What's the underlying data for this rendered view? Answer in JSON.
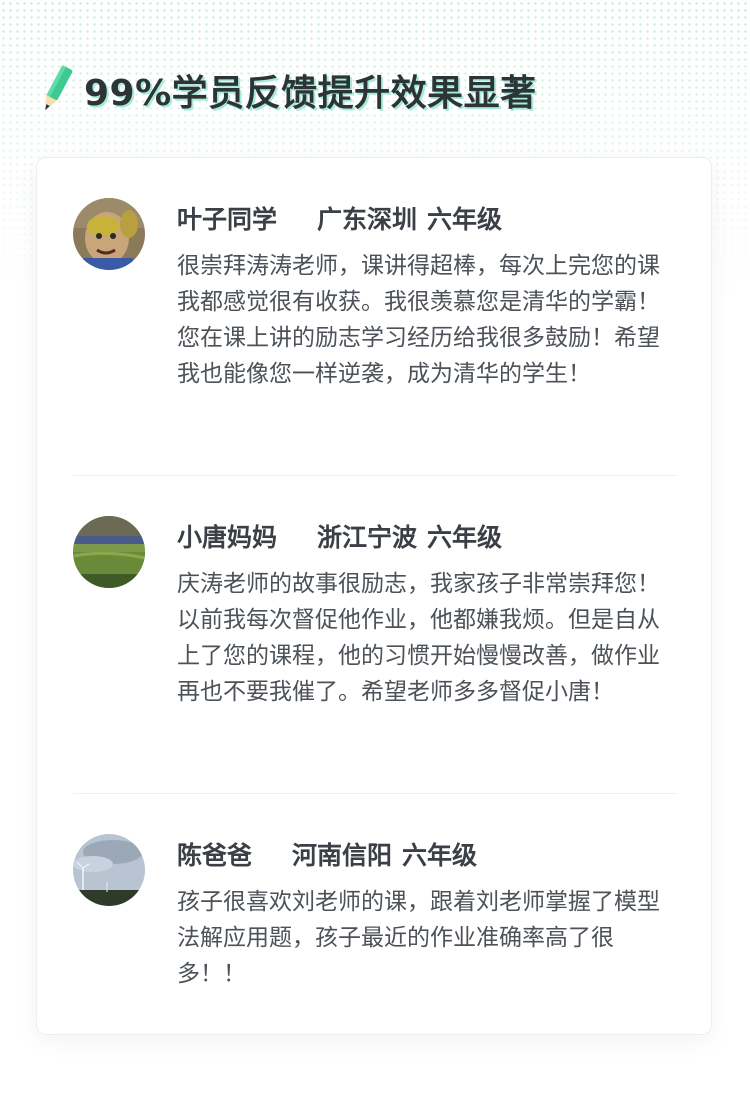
{
  "header": {
    "title": "99%学员反馈提升效果显著",
    "icon": "pencil-icon"
  },
  "colors": {
    "accent": "#3ec98f",
    "title_shadow": "#a8ecd6",
    "text": "#4c5258"
  },
  "reviews": [
    {
      "name": "叶子同学",
      "region": "广东深圳",
      "grade": "六年级",
      "text": "很崇拜涛涛老师，课讲得超棒，每次上完您的课我都感觉很有收获。我很羡慕您是清华的学霸！您在课上讲的励志学习经历给我很多鼓励！希望我也能像您一样逆袭，成为清华的学生！"
    },
    {
      "name": "小唐妈妈",
      "region": "浙江宁波",
      "grade": "六年级",
      "text": "庆涛老师的故事很励志，我家孩子非常崇拜您！以前我每次督促他作业，他都嫌我烦。但是自从上了您的课程，他的习惯开始慢慢改善，做作业再也不要我催了。希望老师多多督促小唐！"
    },
    {
      "name": "陈爸爸",
      "region": "河南信阳",
      "grade": "六年级",
      "text": "孩子很喜欢刘老师的课，跟着刘老师掌握了模型法解应用题，孩子最近的作业准确率高了很多！！"
    }
  ]
}
